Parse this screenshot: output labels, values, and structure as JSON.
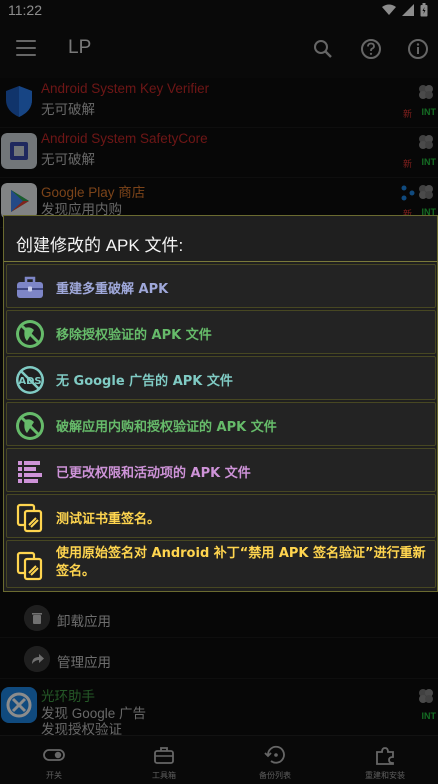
{
  "status_bar": {
    "time": "11:22"
  },
  "app_bar": {
    "title": "LP"
  },
  "apps": [
    {
      "name": "Android System Key Verifier",
      "status": "无可破解",
      "name_color": "#c62828",
      "tag_new": "新",
      "tag_int": "INT",
      "icon": "shield-icon"
    },
    {
      "name": "Android System SafetyCore",
      "status": "无可破解",
      "name_color": "#c62828",
      "tag_new": "新",
      "tag_int": "INT",
      "icon": "chip-icon"
    },
    {
      "name": "Google Play 商店",
      "status": "发现应用内购",
      "name_color": "#e07b2f",
      "tag_new": "新",
      "tag_int": "INT",
      "icon": "play-store-icon"
    },
    {
      "name": "光环助手",
      "status": "发现 Google 广告",
      "status2": "发现授权验证",
      "name_color": "#43a047",
      "tag_int": "INT",
      "icon": "halo-icon"
    }
  ],
  "dialog": {
    "title": "创建修改的 APK 文件:",
    "options": [
      {
        "label": "重建多重破解 APK",
        "color": "#9fa8da",
        "icon": "toolbox-icon"
      },
      {
        "label": "移除授权验证的 APK 文件",
        "color": "#66bb6a",
        "icon": "no-license-icon"
      },
      {
        "label": "无 Google 广告的 APK 文件",
        "color": "#80cbc4",
        "icon": "no-ads-icon"
      },
      {
        "label": "破解应用内购和授权验证的 APK 文件",
        "color": "#66bb6a",
        "icon": "no-license-icon"
      },
      {
        "label": "已更改权限和活动项的 APK 文件",
        "color": "#ce93d8",
        "icon": "list-icon"
      },
      {
        "label": "测试证书重签名。",
        "color": "#ffd54f",
        "icon": "signature-icon"
      },
      {
        "label": "使用原始签名对 Android 补丁“禁用 APK 签名验证”进行重新签名。",
        "color": "#ffd54f",
        "icon": "signature-icon"
      }
    ]
  },
  "menu_rows": [
    {
      "label": "卸载应用",
      "icon": "trash-icon"
    },
    {
      "label": "管理应用",
      "icon": "share-icon"
    }
  ],
  "bottom_nav": [
    {
      "label": "开关",
      "icon": "toggle-icon"
    },
    {
      "label": "工具箱",
      "icon": "toolbox-icon"
    },
    {
      "label": "备份列表",
      "icon": "backup-icon"
    },
    {
      "label": "重建和安装",
      "icon": "puzzle-icon"
    }
  ]
}
